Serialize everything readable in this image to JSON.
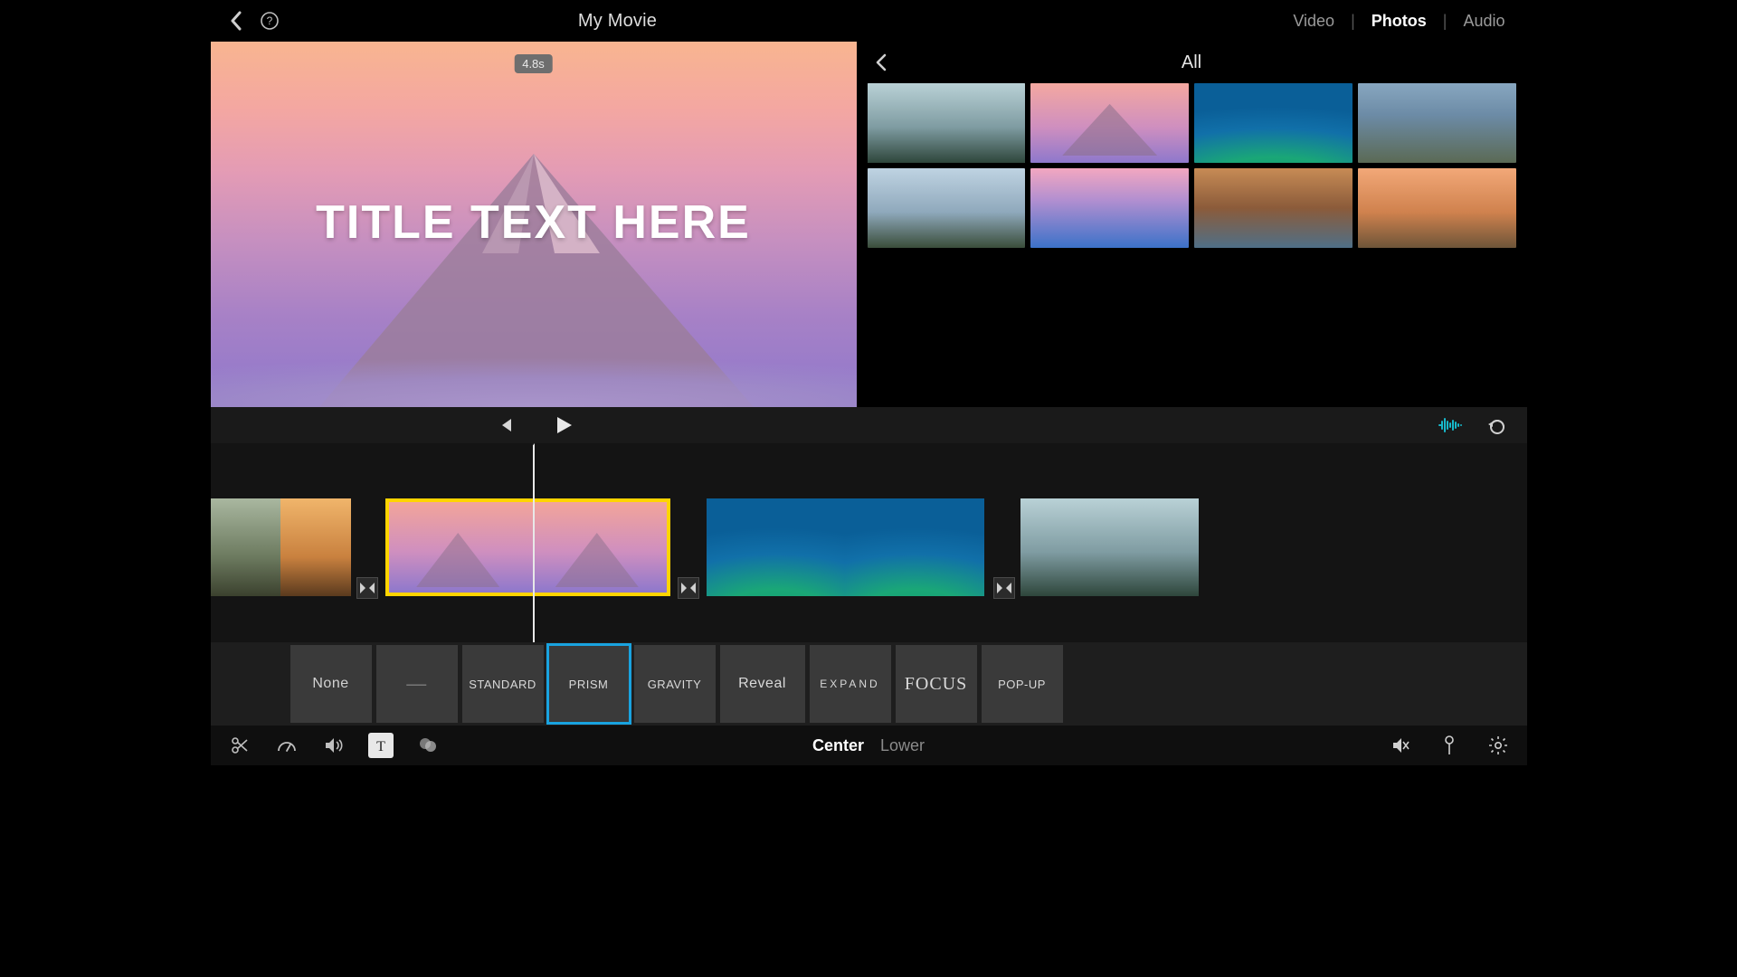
{
  "header": {
    "title": "My Movie",
    "tabs": [
      "Video",
      "Photos",
      "Audio"
    ],
    "active_tab": "Photos"
  },
  "preview": {
    "duration_badge": "4.8s",
    "title_text": "TITLE TEXT HERE"
  },
  "library": {
    "heading": "All"
  },
  "title_styles": {
    "options": [
      "None",
      "—",
      "STANDARD",
      "PRISM",
      "GRAVITY",
      "Reveal",
      "EXPAND",
      "FOCUS",
      "POP-UP"
    ],
    "selected": "PRISM"
  },
  "position": {
    "options": [
      "Center",
      "Lower"
    ],
    "active": "Center"
  },
  "timeline": {
    "selected_clip_has_title": "T"
  },
  "colors": {
    "accent": "#19a3e0",
    "selection": "#ffd400",
    "waveform": "#17b8c9"
  }
}
